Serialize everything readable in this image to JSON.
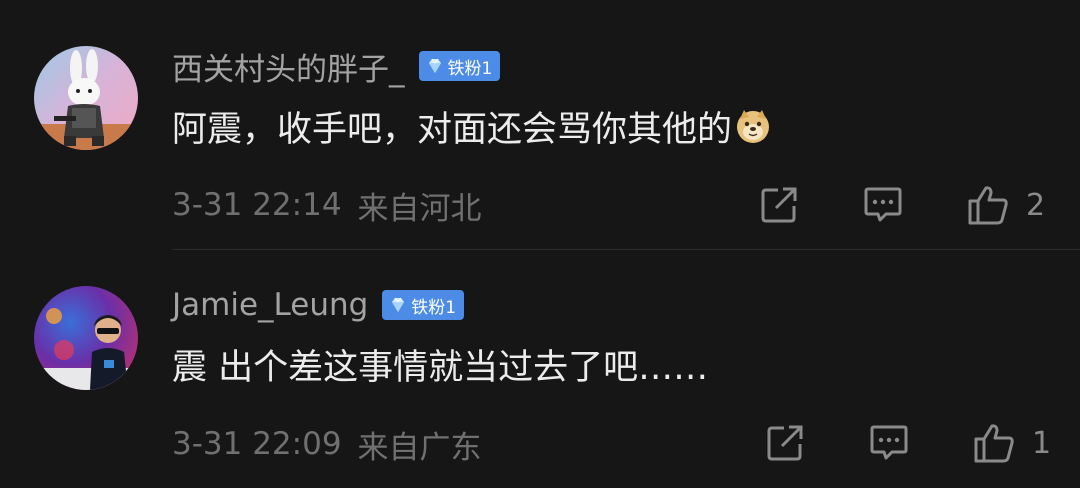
{
  "comments": [
    {
      "username": "西关村头的胖子_",
      "badge": "铁粉1",
      "text": "阿震，收手吧，对面还会骂你其他的",
      "emoji": "doge-emoji",
      "time": "3-31 22:14",
      "location": "来自河北",
      "like_count": "2",
      "avatar": "rabbit-character-avatar"
    },
    {
      "username": "Jamie_Leung",
      "badge": "铁粉1",
      "text": "震 出个差这事情就当过去了吧……",
      "time": "3-31 22:09",
      "location": "来自广东",
      "like_count": "1",
      "avatar": "person-with-sunglasses-avatar"
    }
  ],
  "icons": {
    "share": "share-icon",
    "reply": "comment-icon",
    "like": "thumbs-up-icon",
    "badge": "diamond-icon"
  },
  "colors": {
    "background": "#161616",
    "badge": "#4d8ce6",
    "username": "#a3a3a3",
    "text": "#ececec",
    "meta": "#707070"
  }
}
